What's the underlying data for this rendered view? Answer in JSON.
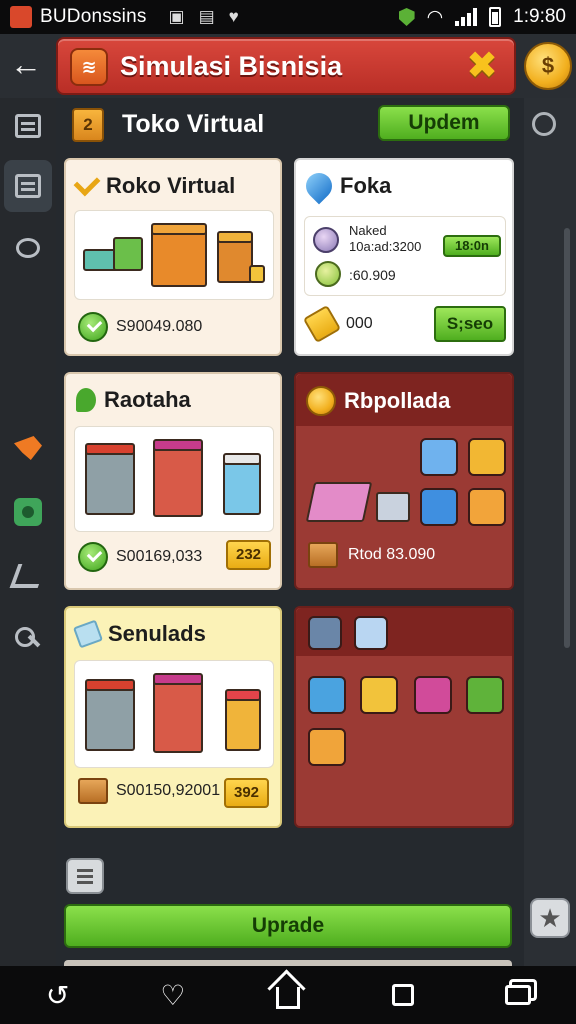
{
  "status_bar": {
    "app_title": "BUDonssins",
    "time": "1:9:80"
  },
  "header": {
    "title": "Simulasi Bisnisia",
    "logo_glyph": "≋",
    "coin_glyph": "$"
  },
  "main": {
    "title": "Toko Virtual",
    "title_icon_glyph": "2",
    "update_label": "Updem",
    "upgrade_label": "Uprade"
  },
  "cards": {
    "c1": {
      "title": "Roko Virtual",
      "value": "S90049.080"
    },
    "c2": {
      "title": "Foka",
      "info_line1": "Naked",
      "info_line2": "10a:ad:3200",
      "info_badge": "18:0n",
      "info_line3": ":60.909",
      "bottom_value": "000",
      "action_label": "S;seo"
    },
    "c3": {
      "title": "Raotaha",
      "value": "S00169,033",
      "badge": "232"
    },
    "c4": {
      "title": "Rbpollada",
      "value": "Rtod 83.090"
    },
    "c5": {
      "title": "Senulads",
      "value": "S00150,92001",
      "badge": "392"
    }
  },
  "colors": {
    "accent_red": "#c8362d",
    "accent_green": "#5fbf2a",
    "accent_gold": "#f2b01f"
  },
  "icons": {
    "back": "arrow-left-icon",
    "close": "crossed-tools-icon",
    "star": "star-icon"
  }
}
